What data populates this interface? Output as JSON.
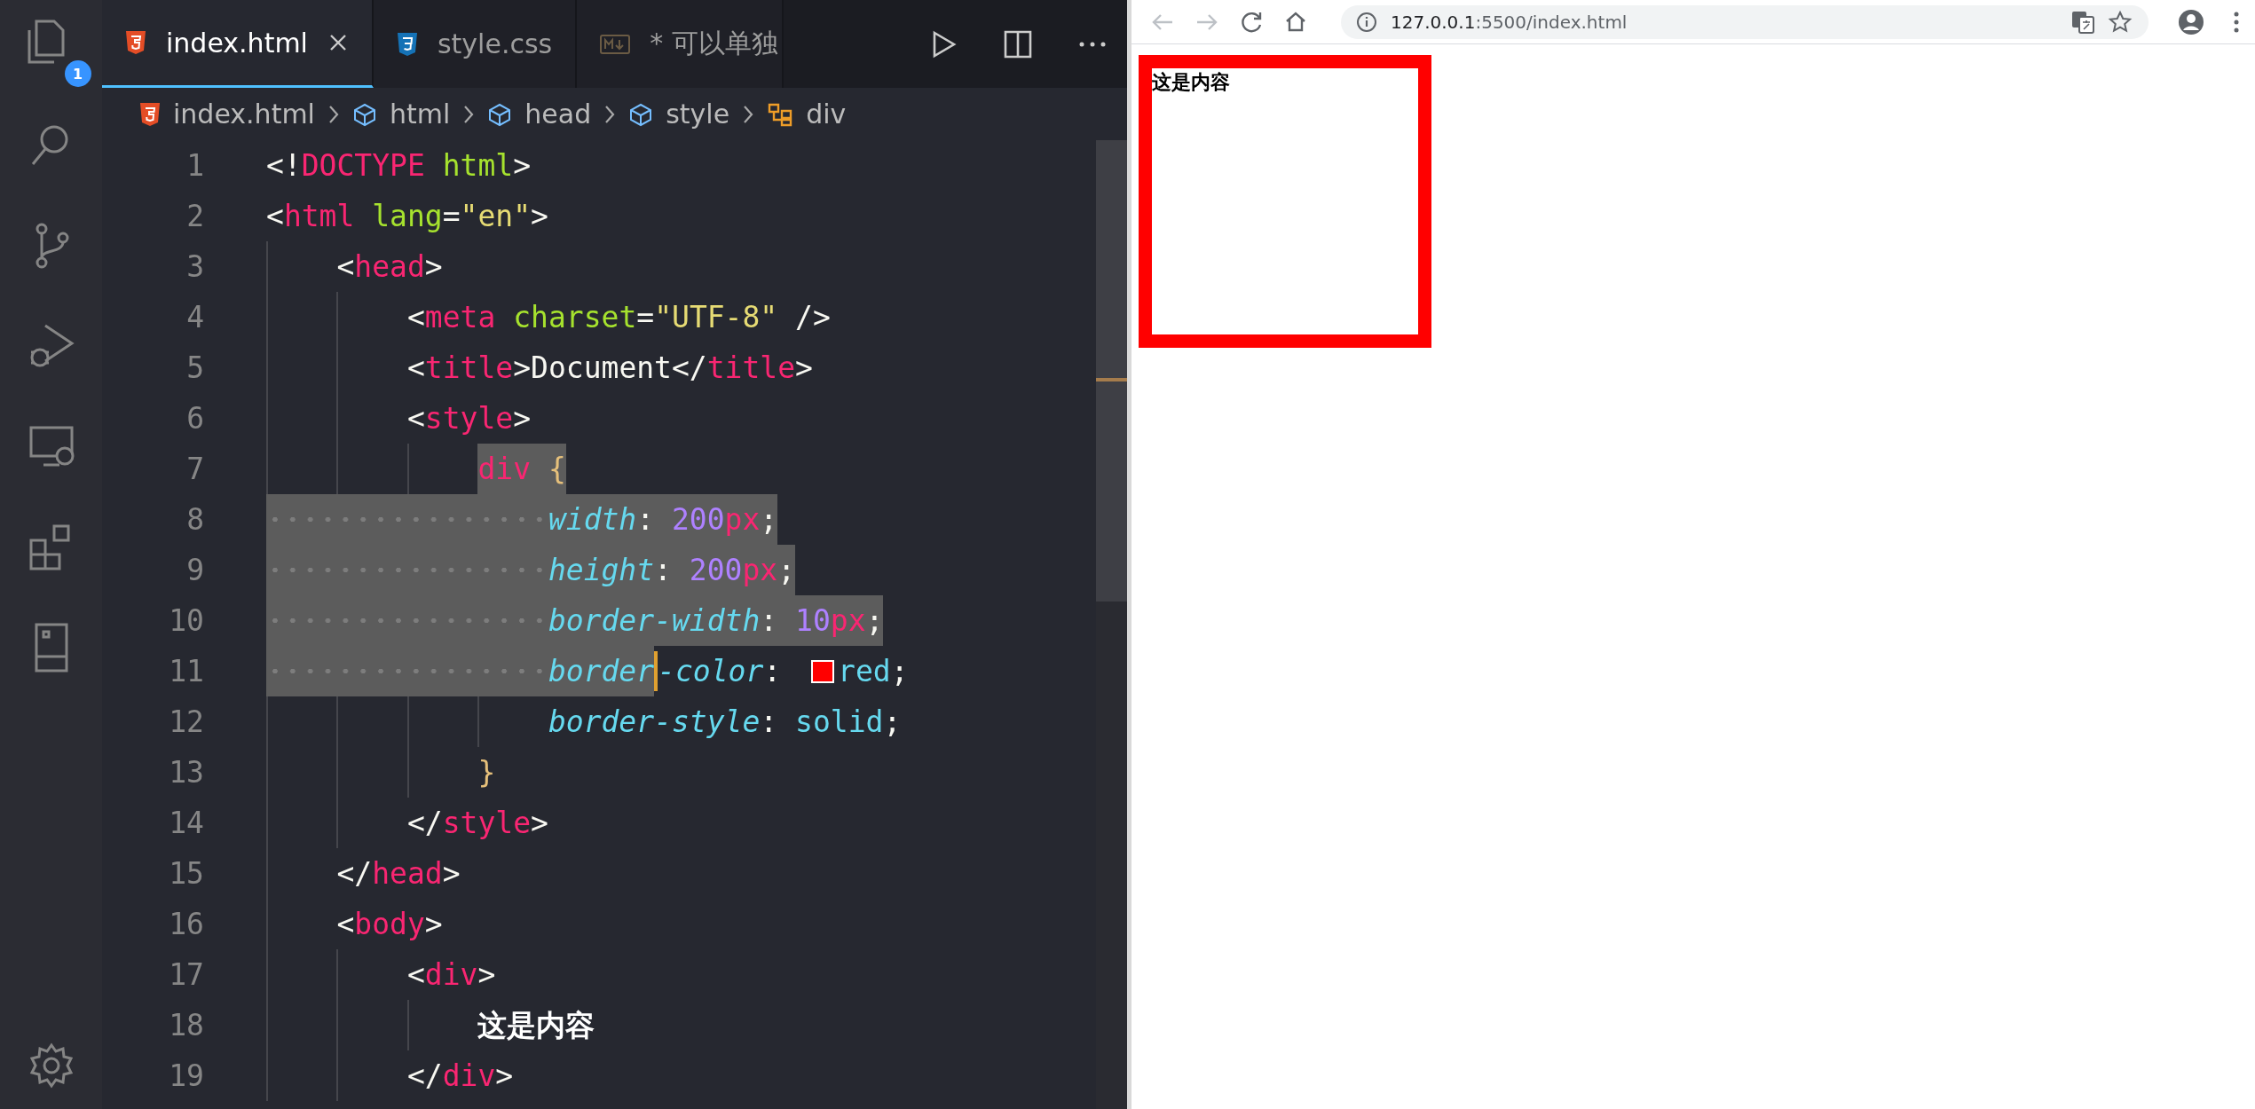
{
  "activity_bar": {
    "items": [
      {
        "kind": "files",
        "badge": "1"
      },
      {
        "kind": "search"
      },
      {
        "kind": "source-control"
      },
      {
        "kind": "run"
      },
      {
        "kind": "remote"
      },
      {
        "kind": "extensions"
      },
      {
        "kind": "panel"
      }
    ],
    "bottom": [
      {
        "kind": "settings"
      }
    ]
  },
  "tabs": [
    {
      "label": "index.html",
      "kind": "html",
      "selected": true
    },
    {
      "label": "style.css",
      "kind": "css",
      "selected": false
    },
    {
      "label": "* 可以单独",
      "kind": "markdown",
      "selected": false
    }
  ],
  "breadcrumbs": [
    {
      "label": "index.html",
      "kind": "html"
    },
    {
      "label": "html",
      "kind": "element"
    },
    {
      "label": "head",
      "kind": "element"
    },
    {
      "label": "style",
      "kind": "element"
    },
    {
      "label": "div",
      "kind": "selector"
    }
  ],
  "editor": {
    "lines": [
      {
        "number": "1",
        "tokens": [
          {
            "text": "<!",
            "kind": "p",
            "selected": false
          },
          {
            "text": "DOCTYPE",
            "kind": "t",
            "selected": false
          },
          {
            "text": " html",
            "kind": "a",
            "selected": false
          },
          {
            "text": ">",
            "kind": "p",
            "selected": false
          }
        ]
      },
      {
        "number": "2",
        "tokens": [
          {
            "text": "<",
            "kind": "p",
            "selected": false
          },
          {
            "text": "html",
            "kind": "t",
            "selected": false
          },
          {
            "text": " lang",
            "kind": "a",
            "selected": false
          },
          {
            "text": "=",
            "kind": "p",
            "selected": false
          },
          {
            "text": "\"en\"",
            "kind": "s",
            "selected": false
          },
          {
            "text": ">",
            "kind": "p",
            "selected": false
          }
        ]
      },
      {
        "number": "3",
        "indent_selected": false,
        "tokens": [
          {
            "text": "    <",
            "kind": "p",
            "selected": false
          },
          {
            "text": "head",
            "kind": "t",
            "selected": false
          },
          {
            "text": ">",
            "kind": "p",
            "selected": false
          }
        ]
      },
      {
        "number": "4",
        "indent_selected": false,
        "tokens": [
          {
            "text": "        <",
            "kind": "p",
            "selected": false
          },
          {
            "text": "meta",
            "kind": "t",
            "selected": false
          },
          {
            "text": " charset",
            "kind": "a",
            "selected": false
          },
          {
            "text": "=",
            "kind": "p",
            "selected": false
          },
          {
            "text": "\"UTF-8\"",
            "kind": "s",
            "selected": false
          },
          {
            "text": " />",
            "kind": "p",
            "selected": false
          }
        ]
      },
      {
        "number": "5",
        "indent_selected": false,
        "tokens": [
          {
            "text": "        <",
            "kind": "p",
            "selected": false
          },
          {
            "text": "title",
            "kind": "t",
            "selected": false
          },
          {
            "text": ">Document</",
            "kind": "p",
            "selected": false
          },
          {
            "text": "title",
            "kind": "t",
            "selected": false
          },
          {
            "text": ">",
            "kind": "p",
            "selected": false
          }
        ]
      },
      {
        "number": "6",
        "indent_selected": false,
        "tokens": [
          {
            "text": "        <",
            "kind": "p",
            "selected": false
          },
          {
            "text": "style",
            "kind": "t",
            "selected": false
          },
          {
            "text": ">",
            "kind": "p",
            "selected": false
          }
        ]
      },
      {
        "number": "7",
        "indent_selected": false,
        "tokens": [
          {
            "text": "            div",
            "kind": "t",
            "selected": true
          },
          {
            "text": " {",
            "kind": "b",
            "selected": true
          }
        ]
      },
      {
        "number": "8",
        "indent_selected": true,
        "tokens": [
          {
            "text": "                width",
            "kind": "k",
            "selected": true
          },
          {
            "text": ": ",
            "kind": "p",
            "selected": true
          },
          {
            "text": "200",
            "kind": "n",
            "selected": true
          },
          {
            "text": "px",
            "kind": "u",
            "selected": true
          },
          {
            "text": ";",
            "kind": "p",
            "selected": true
          }
        ]
      },
      {
        "number": "9",
        "indent_selected": true,
        "tokens": [
          {
            "text": "                height",
            "kind": "k",
            "selected": true
          },
          {
            "text": ": ",
            "kind": "p",
            "selected": true
          },
          {
            "text": "200",
            "kind": "n",
            "selected": true
          },
          {
            "text": "px",
            "kind": "u",
            "selected": true
          },
          {
            "text": ";",
            "kind": "p",
            "selected": true
          }
        ]
      },
      {
        "number": "10",
        "indent_selected": true,
        "tokens": [
          {
            "text": "                border-width",
            "kind": "k",
            "selected": true
          },
          {
            "text": ": ",
            "kind": "p",
            "selected": true
          },
          {
            "text": "10",
            "kind": "n",
            "selected": true
          },
          {
            "text": "px",
            "kind": "u",
            "selected": true
          },
          {
            "text": ";",
            "kind": "p",
            "selected": true
          }
        ]
      },
      {
        "number": "11",
        "indent_selected": true,
        "tokens": [
          {
            "text": "                border",
            "kind": "k",
            "selected": true
          },
          {
            "kind": "cursor"
          },
          {
            "text": "-color",
            "kind": "k",
            "selected": false
          },
          {
            "text": ": ",
            "kind": "p",
            "selected": false
          },
          {
            "kind": "swatch",
            "color": "#ff0000"
          },
          {
            "text": "red",
            "kind": "v",
            "selected": false
          },
          {
            "text": ";",
            "kind": "p",
            "selected": false
          }
        ]
      },
      {
        "number": "12",
        "indent_selected": false,
        "tokens": [
          {
            "text": "                border-style",
            "kind": "k",
            "selected": false
          },
          {
            "text": ": ",
            "kind": "p",
            "selected": false
          },
          {
            "text": "solid",
            "kind": "v",
            "selected": false
          },
          {
            "text": ";",
            "kind": "p",
            "selected": false
          }
        ]
      },
      {
        "number": "13",
        "indent_selected": false,
        "tokens": [
          {
            "text": "            }",
            "kind": "b",
            "selected": false
          }
        ]
      },
      {
        "number": "14",
        "indent_selected": false,
        "tokens": [
          {
            "text": "        </",
            "kind": "p",
            "selected": false
          },
          {
            "text": "style",
            "kind": "t",
            "selected": false
          },
          {
            "text": ">",
            "kind": "p",
            "selected": false
          }
        ]
      },
      {
        "number": "15",
        "indent_selected": false,
        "tokens": [
          {
            "text": "    </",
            "kind": "p",
            "selected": false
          },
          {
            "text": "head",
            "kind": "t",
            "selected": false
          },
          {
            "text": ">",
            "kind": "p",
            "selected": false
          }
        ]
      },
      {
        "number": "16",
        "indent_selected": false,
        "tokens": [
          {
            "text": "    <",
            "kind": "p",
            "selected": false
          },
          {
            "text": "body",
            "kind": "t",
            "selected": false
          },
          {
            "text": ">",
            "kind": "p",
            "selected": false
          }
        ]
      },
      {
        "number": "17",
        "indent_selected": false,
        "tokens": [
          {
            "text": "        <",
            "kind": "p",
            "selected": false
          },
          {
            "text": "div",
            "kind": "t",
            "selected": false
          },
          {
            "text": ">",
            "kind": "p",
            "selected": false
          }
        ]
      },
      {
        "number": "18",
        "indent_selected": false,
        "tokens": [
          {
            "text": "            这是内容",
            "kind": "x",
            "selected": false
          }
        ]
      },
      {
        "number": "19",
        "indent_selected": false,
        "tokens": [
          {
            "text": "        </",
            "kind": "p",
            "selected": false
          },
          {
            "text": "div",
            "kind": "t",
            "selected": false
          },
          {
            "text": ">",
            "kind": "p",
            "selected": false
          }
        ]
      }
    ]
  },
  "browser": {
    "nav": [
      {
        "kind": "back",
        "disabled": true
      },
      {
        "kind": "forward",
        "disabled": true
      },
      {
        "kind": "reload",
        "disabled": false
      },
      {
        "kind": "home",
        "disabled": false
      }
    ],
    "address": {
      "host": "127.0.0.1",
      "rest": ":5500/index.html"
    },
    "page": {
      "box_text": "这是内容"
    }
  }
}
